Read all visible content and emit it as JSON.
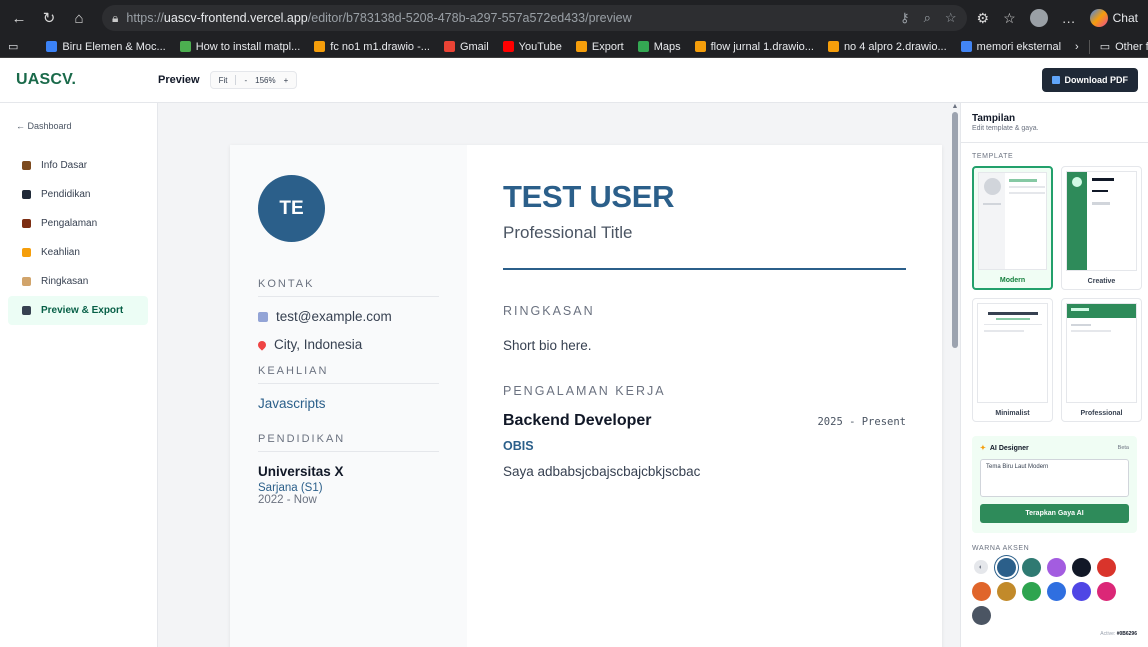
{
  "browser": {
    "url_prefix": "https://",
    "url_domain": "uascv-frontend.vercel.app",
    "url_path": "/editor/b783138d-5208-478b-a297-557a572ed433/preview",
    "chat_label": "Chat",
    "bookmarks": [
      {
        "label": "Biru Elemen & Moc...",
        "color": "#3b82f6"
      },
      {
        "label": "How to install matpl...",
        "color": "#4caf50"
      },
      {
        "label": "fc no1 m1.drawio -...",
        "color": "#f59e0b"
      },
      {
        "label": "Gmail",
        "color": "#ea4335"
      },
      {
        "label": "YouTube",
        "color": "#ff0000"
      },
      {
        "label": "Export",
        "color": "#f59e0b"
      },
      {
        "label": "Maps",
        "color": "#34a853"
      },
      {
        "label": "flow jurnal 1.drawio...",
        "color": "#f59e0b"
      },
      {
        "label": "no 4 alpro 2.drawio...",
        "color": "#f59e0b"
      },
      {
        "label": "memori eksternal",
        "color": "#4285f4"
      }
    ],
    "other_favorites": "Other favorites"
  },
  "app": {
    "brand": "UASCV.",
    "preview_label": "Preview",
    "zoom_fit": "Fit",
    "zoom_minus": "-",
    "zoom_level": "156%",
    "zoom_plus": "+",
    "download_label": "Download PDF"
  },
  "sidebar": {
    "back_label": "← Dashboard",
    "items": [
      {
        "label": "Info Dasar",
        "color": "#7c4a1e"
      },
      {
        "label": "Pendidikan",
        "color": "#1f2937"
      },
      {
        "label": "Pengalaman",
        "color": "#7c2d12"
      },
      {
        "label": "Keahlian",
        "color": "#f59e0b"
      },
      {
        "label": "Ringkasan",
        "color": "#d1a46b"
      },
      {
        "label": "Preview & Export",
        "color": "#374151"
      }
    ]
  },
  "cv": {
    "initials": "TE",
    "kontak_title": "KONTAK",
    "email": "test@example.com",
    "location": "City, Indonesia",
    "keahlian_title": "KEAHLIAN",
    "skill": "Javascripts",
    "pendidikan_title": "PENDIDIKAN",
    "edu_name": "Universitas X",
    "edu_degree": "Sarjana (S1)",
    "edu_years": "2022 - Now",
    "name": "TEST USER",
    "title": "Professional Title",
    "ringkasan_title": "RINGKASAN",
    "ringkasan_text": "Short bio here.",
    "pengalaman_title": "PENGALAMAN KERJA",
    "job_title": "Backend Developer",
    "job_date": "2025 - Present",
    "job_company": "OBIS",
    "job_desc": "Saya adbabsjcbajscbajcbkjscbac"
  },
  "panel": {
    "title": "Tampilan",
    "subtitle": "Edit template & gaya.",
    "template_label": "TEMPLATE",
    "templates": [
      "Modern",
      "Creative",
      "Minimalist",
      "Professional"
    ],
    "ai_title": "AI Designer",
    "ai_beta": "Beta",
    "ai_input": "Tema Biru Laut Modern",
    "ai_button": "Terapkan Gaya AI",
    "accent_label": "WARNA AKSEN",
    "active_prefix": "Active:",
    "active_value": "#0B6296",
    "accent_colors": [
      "#2b5f8a",
      "#2f7a72",
      "#a35ce0",
      "#111827",
      "#d9342b",
      "#e0652a",
      "#c28a2a",
      "#2ea44f",
      "#2f6fe0",
      "#4f46e5",
      "#db2777",
      "#4b5563"
    ]
  }
}
